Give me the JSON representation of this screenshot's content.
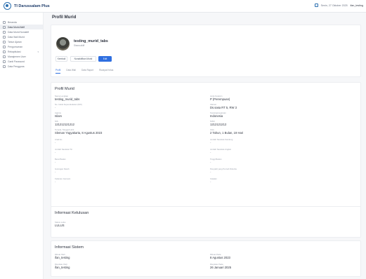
{
  "app": {
    "name": "TI Darussalam Plus"
  },
  "topbar": {
    "date": "Senin, 27 Oktober 2025",
    "user": "ifan_testing"
  },
  "sidebar": {
    "items": [
      {
        "label": "Beranda"
      },
      {
        "label": "Data Murid Aktif"
      },
      {
        "label": "Data Murid Nonaktif"
      },
      {
        "label": "Data Wali Murid"
      },
      {
        "label": "Tahun Ajaran"
      },
      {
        "label": "Pengumuman"
      },
      {
        "label": "Rekapitulasi"
      },
      {
        "label": "Manajemen User"
      },
      {
        "label": "Ganti Password"
      },
      {
        "label": "Data Pengguna"
      }
    ]
  },
  "page": {
    "title": "Profil Murid"
  },
  "profile": {
    "name": "testing_murid_tabs",
    "role": "Siswa aktif",
    "buttons": {
      "back": "Kembali",
      "delete": "Nonaktifkan Murid",
      "edit": "Edit"
    },
    "tabs": [
      "Profil",
      "Data Wali",
      "Data Raport",
      "Riwayat Kelas"
    ]
  },
  "profile_section": {
    "title": "Profil Murid",
    "fields": [
      {
        "label": "Nama Lengkap",
        "value": "testing_murid_tabs"
      },
      {
        "label": "Jenis Kelamin",
        "value": "P (Perempuan)"
      },
      {
        "label": "No. Induk Kependudukan (NIK)",
        "value": "-"
      },
      {
        "label": "Alamat",
        "value": "Ds.sasa RT 5, RW 3"
      },
      {
        "label": "Agama",
        "value": "Islam"
      },
      {
        "label": "Kewarganegaraan",
        "value": "Indonesia"
      },
      {
        "label": "NIS",
        "value": "121212121212"
      },
      {
        "label": "NISN",
        "value": "1212121212"
      },
      {
        "label": "Tempat, Tanggal Lahir",
        "value": "Sleman Yogyakarta, 8 Agustus 2023"
      },
      {
        "label": "Usia",
        "value": "2 Tahun, 1 Bulan, 19 Hari"
      },
      {
        "label": "Anak ke-",
        "value": "-"
      },
      {
        "label": "Jumlah Saudara Kandung",
        "value": "-"
      },
      {
        "label": "Jumlah Saudara Tiri",
        "value": "-"
      },
      {
        "label": "Jumlah Saudara Angkat",
        "value": "-"
      },
      {
        "label": "Berat Badan",
        "value": "-"
      },
      {
        "label": "Tinggi Badan",
        "value": "-"
      },
      {
        "label": "Golongan Darah",
        "value": "-"
      },
      {
        "label": "Penyakit yang Pernah Diderita",
        "value": "-"
      },
      {
        "label": "Kelainan Jasmani",
        "value": "-"
      },
      {
        "label": "Catatan",
        "value": "-"
      }
    ]
  },
  "graduation": {
    "title": "Informasi Kelulusan",
    "fields": [
      {
        "label": "Status Lulus",
        "value": "LULUS"
      }
    ]
  },
  "system": {
    "title": "Informasi Sistem",
    "fields": [
      {
        "label": "Dibuat Oleh",
        "value": "ifan_testing"
      },
      {
        "label": "Dibuat Pada",
        "value": "8 Agustus 2023"
      },
      {
        "label": "Diupdate Oleh",
        "value": "ifan_testing"
      },
      {
        "label": "Diupdate Pada",
        "value": "26 Januari 2025"
      }
    ]
  }
}
